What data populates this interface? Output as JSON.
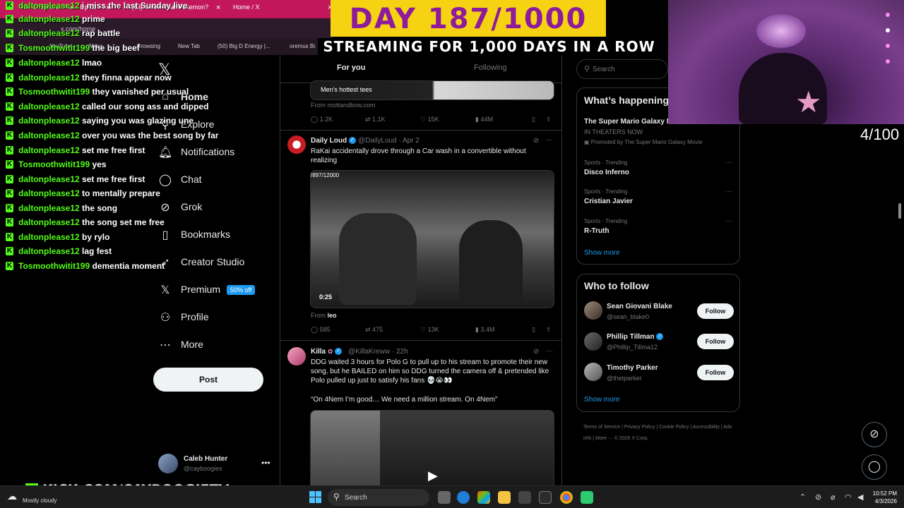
{
  "browser": {
    "tabs": [
      {
        "title": "The Crossover Pod - Ep 12 - 8o"
      },
      {
        "title": "(13) Who's That Pokemon? - Yo"
      },
      {
        "title": "Home / X"
      }
    ],
    "address": "x.com/home",
    "bookmarks": [
      "YouTube",
      "Maps",
      "Browsing",
      "New Tab",
      "(50) Big D Energy |...",
      "oremus Bi"
    ]
  },
  "banner": {
    "title": "DAY 187/1000",
    "subtitle": "STREAMING FOR 1,000 DAYS IN A ROW"
  },
  "stream_counter": "4/100",
  "chat": [
    {
      "user": "daltonplease12",
      "msg": "i miss the last Sunday live"
    },
    {
      "user": "daltonplease12",
      "msg": "prime"
    },
    {
      "user": "daltonplease12",
      "msg": "rap battle"
    },
    {
      "user": "Tosmoothwitit199",
      "msg": "the big beef"
    },
    {
      "user": "daltonplease12",
      "msg": "lmao"
    },
    {
      "user": "daltonplease12",
      "msg": "they finna appear now"
    },
    {
      "user": "Tosmoothwitit199",
      "msg": "they vanished per usual"
    },
    {
      "user": "daltonplease12",
      "msg": "called our song ass and dipped"
    },
    {
      "user": "daltonplease12",
      "msg": "saying you was glazing une"
    },
    {
      "user": "daltonplease12",
      "msg": "over you was the best song by far"
    },
    {
      "user": "daltonplease12",
      "msg": "set me free first"
    },
    {
      "user": "Tosmoothwitit199",
      "msg": "yes"
    },
    {
      "user": "daltonplease12",
      "msg": "set me free first"
    },
    {
      "user": "daltonplease12",
      "msg": "to mentally prepare"
    },
    {
      "user": "daltonplease12",
      "msg": "the song"
    },
    {
      "user": "daltonplease12",
      "msg": "the song set me free"
    },
    {
      "user": "daltonplease12",
      "msg": "by rylo"
    },
    {
      "user": "daltonplease12",
      "msg": "lag fest"
    },
    {
      "user": "Tosmoothwitit199",
      "msg": "dementia moment"
    }
  ],
  "nav": {
    "items": [
      {
        "label": "Home",
        "icon": "home-icon"
      },
      {
        "label": "Explore",
        "icon": "search-icon"
      },
      {
        "label": "Notifications",
        "icon": "bell-icon"
      },
      {
        "label": "Chat",
        "icon": "chat-icon"
      },
      {
        "label": "Grok",
        "icon": "grok-icon"
      },
      {
        "label": "Bookmarks",
        "icon": "bookmark-icon"
      },
      {
        "label": "Creator Studio",
        "icon": "rocket-icon"
      },
      {
        "label": "Premium",
        "icon": "x-logo-icon"
      },
      {
        "label": "Profile",
        "icon": "person-icon"
      },
      {
        "label": "More",
        "icon": "more-circle-icon"
      }
    ],
    "premium_badge": "50% off",
    "post_label": "Post",
    "account": {
      "name": "Caleb Hunter",
      "handle": "@cayboogiex"
    }
  },
  "feed": {
    "tabs": [
      "For you",
      "Following"
    ],
    "ad": {
      "image_caption": "Men's hottest tees",
      "source": "From mottandbow.com",
      "stats": {
        "replies": "1.2K",
        "reposts": "1.1K",
        "likes": "15K",
        "views": "44M"
      }
    },
    "tweets": [
      {
        "name": "Daily Loud",
        "handle": "@DailyLoud",
        "time": "Apr 2",
        "text": "RaKai accidentally drove through a Car wash in a convertible without realizing",
        "video_overlay": "/897/12000",
        "duration": "0:25",
        "from_label": "From",
        "from_name": "leo",
        "stats": {
          "replies": "585",
          "reposts": "475",
          "likes": "13K",
          "views": "3.4M"
        }
      },
      {
        "name": "Killa",
        "handle": "@KillaKreww",
        "time": "22h",
        "text": "DDG waited 3 hours for Polo G to pull up to his stream to promote their new song, but he BAILED on him so DDG turned the camera off & pretended like Polo pulled up just to satisfy his fans 💀😭👀",
        "quote": "“On 4Nem I’m good… We need a million stream. On 4Nem”"
      }
    ]
  },
  "sidebar": {
    "search_placeholder": "Search",
    "happening_title": "What’s happening",
    "promo": {
      "name": "The Super Mario Galaxy M",
      "sub": "IN THEATERS NOW",
      "promoted": "Promoted by The Super Mario Galaxy Movie"
    },
    "trends": [
      {
        "meta": "Sports · Trending",
        "name": "Disco Inferno"
      },
      {
        "meta": "Sports · Trending",
        "name": "Cristian Javier"
      },
      {
        "meta": "Sports · Trending",
        "name": "R-Truth"
      }
    ],
    "show_more": "Show more",
    "who_to_follow_title": "Who to follow",
    "follows": [
      {
        "name": "Sean Giovani Blake",
        "handle": "@sean_blake0",
        "verified": false
      },
      {
        "name": "Phillip Tillman",
        "handle": "@Phillip_Tillma12",
        "verified": true
      },
      {
        "name": "Timothy Parker",
        "handle": "@thetparker",
        "verified": false
      }
    ],
    "follow_label": "Follow",
    "footer": "Terms of Service  |  Privacy Policy  |  Cookie Policy  |  Accessibility  |  Ads info  |  More ···  © 2026 X Corp."
  },
  "overlay_url": "KICK.COM/CAYBOOGIETV",
  "taskbar": {
    "weather": "Mostly cloudy",
    "search": "Search",
    "time": "10:52 PM",
    "date": "4/3/2026"
  },
  "colors": {
    "kick_green": "#53fc18",
    "x_blue": "#1d9bf0",
    "banner_yellow": "#f6d312",
    "banner_purple": "#8e1b9c",
    "tab_pink": "#c2185b"
  }
}
